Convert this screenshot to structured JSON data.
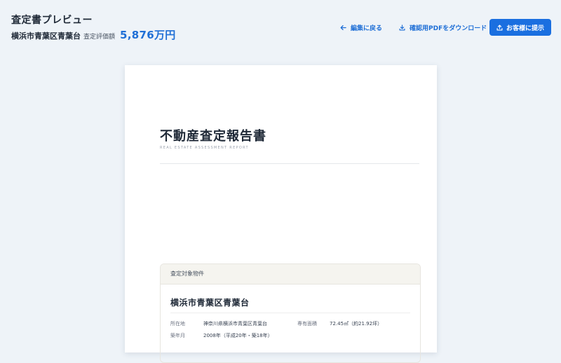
{
  "header": {
    "title": "査定書プレビュー",
    "address": "横浜市青葉区青葉台",
    "price_label": "査定評価額",
    "price_value": "5,876万円"
  },
  "actions": {
    "back_label": "編集に戻る",
    "download_label": "確認用PDFをダウンロード",
    "present_label": "お客様に提示"
  },
  "document": {
    "title": "不動産査定報告書",
    "subtitle": "REAL ESTATE ASSESSMENT REPORT",
    "property_section": {
      "header": "査定対象物件",
      "name": "横浜市青葉区青葉台",
      "location_label": "所在地",
      "location_value": "神奈川県横浜市青葉区青葉台",
      "area_label": "専有面積",
      "area_value": "72.45㎡（約21.92坪）",
      "built_label": "築年月",
      "built_value": "2008年（平成20年・築18年）"
    }
  },
  "colors": {
    "accent": "#1a6fe0",
    "background": "#eef3f8",
    "paper": "#ffffff"
  },
  "icons": {
    "back": "arrow-left-icon",
    "download": "download-icon",
    "present": "share-upload-icon"
  }
}
